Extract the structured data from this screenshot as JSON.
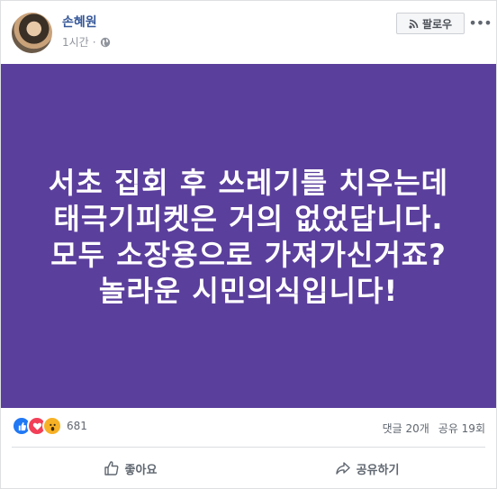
{
  "post": {
    "author": "손혜원",
    "time": "1시간",
    "follow_label": "팔로우",
    "more_glyph": "•••",
    "image_text": "서초 집회 후 쓰레기를 치우는데\n태극기피켓은 거의 없었답니다.\n모두 소장용으로 가져가신거죠?\n놀라운 시민의식입니다!",
    "image_bg_color": "#5b3f9c"
  },
  "reactions": {
    "icons": [
      "like-icon",
      "love-icon",
      "wow-icon"
    ],
    "count": "681",
    "comments": "댓글 20개",
    "shares": "공유 19회"
  },
  "actions": {
    "like_label": "좋아요",
    "share_label": "공유하기"
  }
}
